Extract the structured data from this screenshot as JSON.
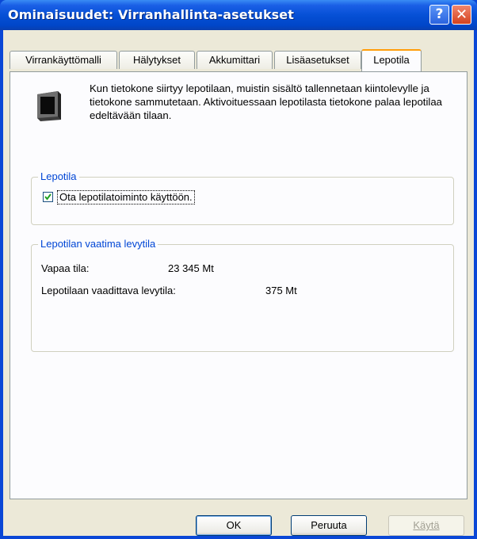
{
  "window": {
    "title": "Ominaisuudet: Virranhallinta-asetukset",
    "help_glyph": "?",
    "close_glyph": "✕"
  },
  "tabs": [
    {
      "label": "Virrankäyttömalli",
      "active": false
    },
    {
      "label": "Hälytykset",
      "active": false
    },
    {
      "label": "Akkumittari",
      "active": false
    },
    {
      "label": "Lisäasetukset",
      "active": false
    },
    {
      "label": "Lepotila",
      "active": true
    }
  ],
  "panel": {
    "icon": "laptop-hibernate-icon",
    "intro_text": "Kun tietokone siirtyy lepotilaan, muistin sisältö tallennetaan kiintolevylle ja tietokone sammutetaan. Aktivoituessaan lepotilasta tietokone palaa lepotilaa edeltävään tilaan.",
    "hibernate_group": {
      "legend": "Lepotila",
      "checkbox_label": "Ota lepotilatoiminto käyttöön.",
      "checked": true
    },
    "disk_group": {
      "legend": "Lepotilan vaatima levytila",
      "free_label": "Vapaa tila:",
      "free_value": "23 345 Mt",
      "required_label": "Lepotilaan vaadittava levytila:",
      "required_value": "375 Mt"
    }
  },
  "buttons": {
    "ok": "OK",
    "cancel": "Peruuta",
    "apply": "Käytä"
  },
  "colors": {
    "titlebar": "#0650d6",
    "legend_text": "#0046d5",
    "active_tab_accent": "#ff9d0a",
    "dialog_bg": "#ece9d8"
  }
}
